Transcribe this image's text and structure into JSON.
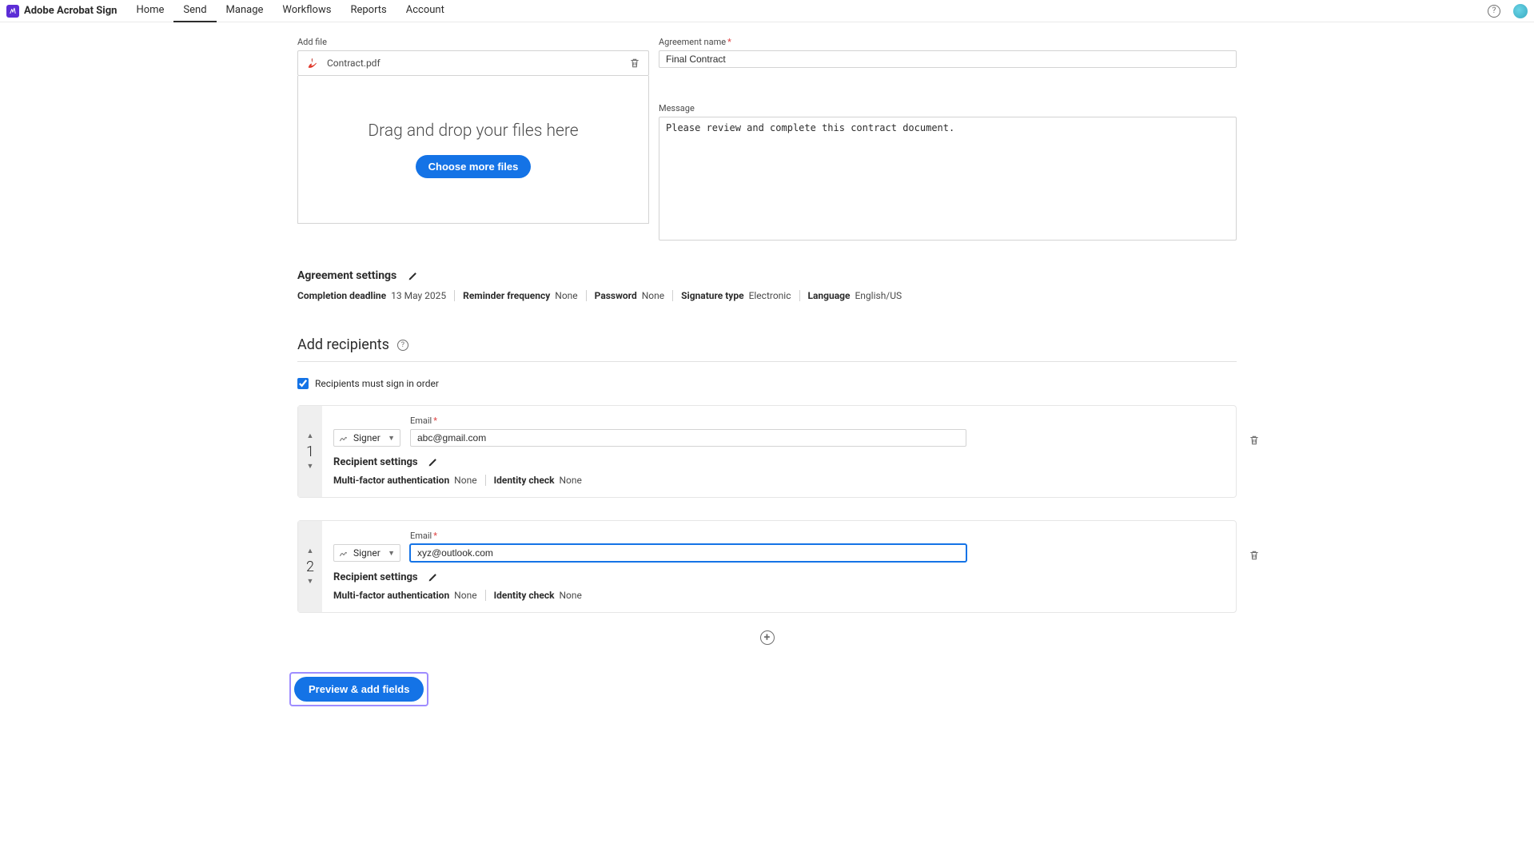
{
  "header": {
    "app_title": "Adobe Acrobat Sign",
    "nav": {
      "home": "Home",
      "send": "Send",
      "manage": "Manage",
      "workflows": "Workflows",
      "reports": "Reports",
      "account": "Account"
    }
  },
  "add_file": {
    "label": "Add file",
    "file_name": "Contract.pdf",
    "drop_text": "Drag and drop your files here",
    "choose_button": "Choose more files"
  },
  "agreement_name": {
    "label": "Agreement name",
    "value": "Final Contract"
  },
  "message": {
    "label": "Message",
    "value": "Please review and complete this contract document."
  },
  "agreement_settings": {
    "title": "Agreement settings",
    "items": {
      "completion_deadline": {
        "label": "Completion deadline",
        "value": "13 May 2025"
      },
      "reminder_frequency": {
        "label": "Reminder frequency",
        "value": "None"
      },
      "password": {
        "label": "Password",
        "value": "None"
      },
      "signature_type": {
        "label": "Signature type",
        "value": "Electronic"
      },
      "language": {
        "label": "Language",
        "value": "English/US"
      }
    }
  },
  "recipients_section": {
    "title": "Add recipients",
    "sign_in_order_label": "Recipients must sign in order",
    "sign_in_order_checked": true
  },
  "recipients": [
    {
      "index": "1",
      "role": "Signer",
      "email_label": "Email",
      "email": "abc@gmail.com",
      "settings_title": "Recipient settings",
      "mfa_label": "Multi-factor authentication",
      "mfa_value": "None",
      "identity_label": "Identity check",
      "identity_value": "None"
    },
    {
      "index": "2",
      "role": "Signer",
      "email_label": "Email",
      "email": "xyz@outlook.com",
      "settings_title": "Recipient settings",
      "mfa_label": "Multi-factor authentication",
      "mfa_value": "None",
      "identity_label": "Identity check",
      "identity_value": "None"
    }
  ],
  "footer": {
    "preview_button": "Preview & add fields"
  }
}
